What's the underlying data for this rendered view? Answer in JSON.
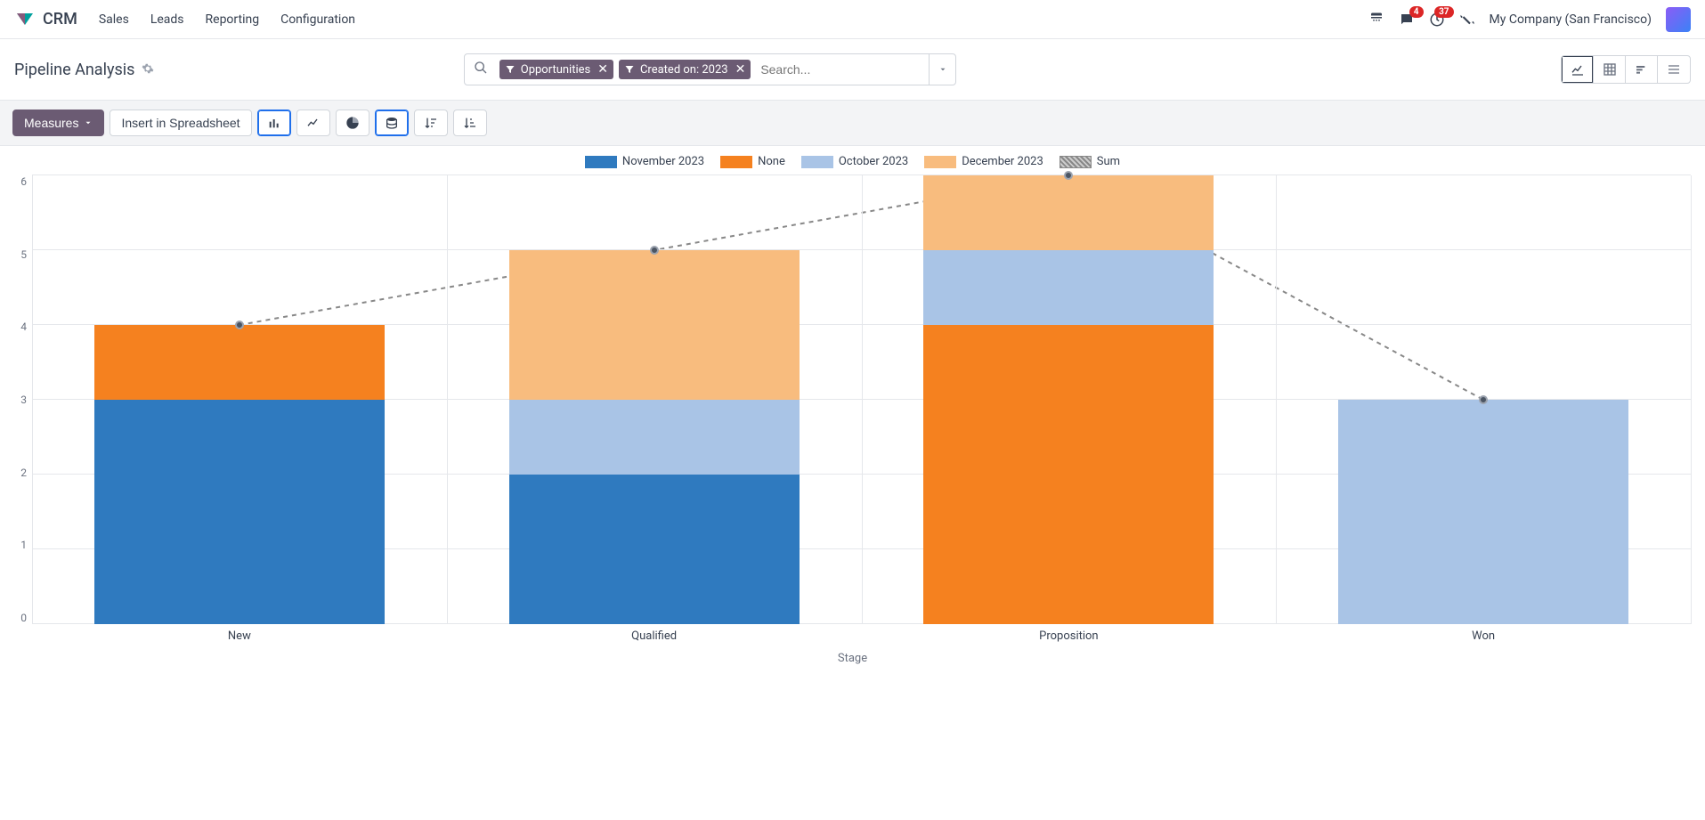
{
  "nav": {
    "app": "CRM",
    "items": [
      "Sales",
      "Leads",
      "Reporting",
      "Configuration"
    ],
    "company": "My Company (San Francisco)",
    "badges": {
      "messages": "4",
      "activities": "37"
    }
  },
  "header": {
    "title": "Pipeline Analysis",
    "search_placeholder": "Search...",
    "facets": [
      {
        "label": "Opportunities"
      },
      {
        "label": "Created on: 2023"
      }
    ],
    "views": [
      "graph",
      "pivot",
      "cohort",
      "list"
    ],
    "active_view": "graph"
  },
  "toolbar": {
    "measures_label": "Measures",
    "insert_label": "Insert in Spreadsheet",
    "chart_types": [
      "bar",
      "line",
      "pie",
      "stacked"
    ],
    "active_types": [
      "bar",
      "stacked"
    ],
    "sorts": [
      "desc",
      "asc"
    ]
  },
  "chart_data": {
    "type": "bar",
    "stacked": true,
    "categories": [
      "New",
      "Qualified",
      "Proposition",
      "Won"
    ],
    "xlabel": "Stage",
    "ylabel": "",
    "ylim": [
      0,
      6
    ],
    "yticks": [
      0,
      1,
      2,
      3,
      4,
      5,
      6
    ],
    "series": [
      {
        "name": "November 2023",
        "color": "#2F7ABF",
        "values": [
          3,
          2,
          0,
          0
        ]
      },
      {
        "name": "None",
        "color": "#F5811F",
        "values": [
          1,
          0,
          4,
          0
        ]
      },
      {
        "name": "October 2023",
        "color": "#A9C4E6",
        "values": [
          0,
          1,
          1,
          3
        ]
      },
      {
        "name": "December 2023",
        "color": "#F8BC7E",
        "values": [
          0,
          2,
          1,
          0
        ]
      }
    ],
    "sum_line": {
      "name": "Sum",
      "values": [
        4,
        5,
        6,
        3
      ]
    }
  }
}
